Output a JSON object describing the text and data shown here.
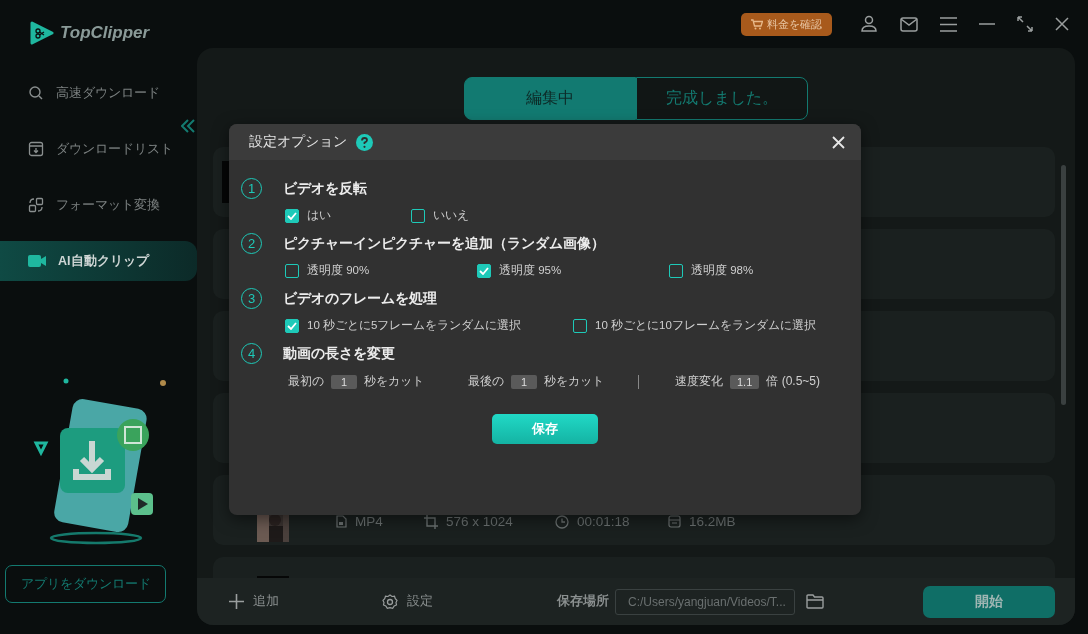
{
  "app": {
    "name": "TopClipper"
  },
  "header": {
    "pricing_button": "料金を確認"
  },
  "sidebar": {
    "items": [
      {
        "label": "高速ダウンロード",
        "selected": false
      },
      {
        "label": "ダウンロードリスト",
        "selected": false
      },
      {
        "label": "フォーマット変換",
        "selected": false
      },
      {
        "label": "AI自動クリップ",
        "selected": true
      }
    ],
    "download_app_button": "アプリをダウンロード"
  },
  "tabs": [
    {
      "label": "編集中",
      "selected": true
    },
    {
      "label": "完成しました。",
      "selected": false
    }
  ],
  "file_info": {
    "format": "MP4",
    "resolution": "576 x 1024",
    "duration": "00:01:18",
    "size": "16.2MB"
  },
  "dialog": {
    "title": "設定オプション",
    "sections": [
      {
        "kind": "options",
        "number": "1",
        "title": "ビデオを反転",
        "options": [
          {
            "label": "はい",
            "checked": true
          },
          {
            "label": "いいえ",
            "checked": false
          }
        ]
      },
      {
        "kind": "options",
        "number": "2",
        "title": "ピクチャーインピクチャーを追加（ランダム画像）",
        "options": [
          {
            "label": "透明度 90%",
            "checked": false
          },
          {
            "label": "透明度 95%",
            "checked": true
          },
          {
            "label": "透明度 98%",
            "checked": false
          }
        ]
      },
      {
        "kind": "options",
        "number": "3",
        "title": "ビデオのフレームを処理",
        "options": [
          {
            "label": "10 秒ごとに5フレームをランダムに選択",
            "checked": true
          },
          {
            "label": "10 秒ごとに10フレームをランダムに選択",
            "checked": false
          }
        ]
      },
      {
        "kind": "fields",
        "number": "4",
        "title": "動画の長さを変更",
        "fields": [
          {
            "prefix": "最初の",
            "value": "1",
            "suffix": "秒をカット"
          },
          {
            "prefix": "最後の",
            "value": "1",
            "suffix": "秒をカット"
          },
          {
            "prefix": "速度変化",
            "value": "1.1",
            "suffix": "倍 (0.5~5)"
          }
        ]
      }
    ],
    "save_button": "保存"
  },
  "bottom_bar": {
    "add": "追加",
    "settings": "設定",
    "save_location_label": "保存場所",
    "save_path": "C:/Users/yangjuan/Videos/T...",
    "start": "開始"
  }
}
